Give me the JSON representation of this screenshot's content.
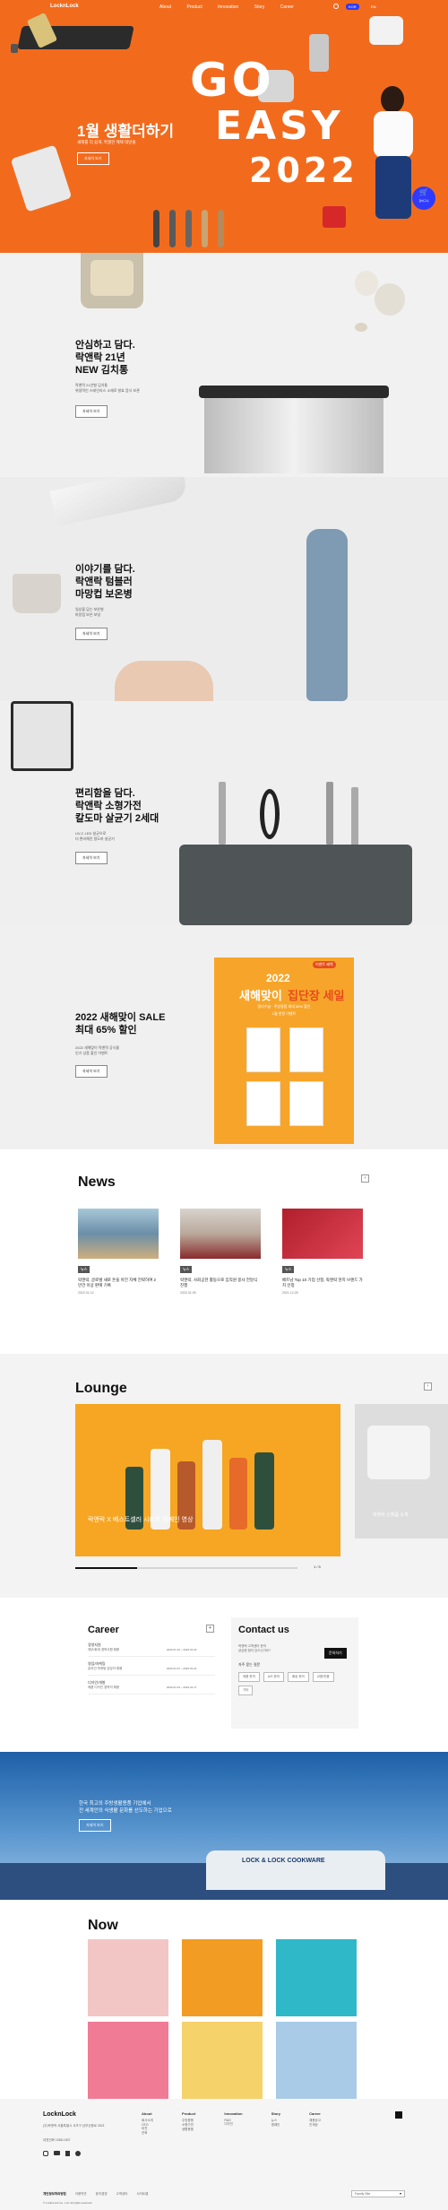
{
  "colors": {
    "hero_bg": "#f26b1d",
    "accent_blue": "#2e3bff",
    "sale_orange": "#f7a52a",
    "sale_red": "#e74b1c",
    "footer_bg": "#f5f5f5"
  },
  "header": {
    "logo": "LocknLock",
    "nav": [
      "About",
      "Product",
      "Innovation",
      "Story",
      "Career"
    ],
    "utils": {
      "search": "search-icon",
      "lang_btn": "KOR",
      "lang": "EN"
    }
  },
  "hero": {
    "title": "1월 생활더하기",
    "subtitle": "새해를 더 쉽게, 특별한 혜택 대방출",
    "more": "자세히 보기",
    "deco_top": "GO",
    "deco_mid": "EASY",
    "deco_year": "2022",
    "fab_label": "장바구니",
    "fab_icon": "cart-icon"
  },
  "promos": [
    {
      "title": "안심하고 담다.\n락앤락 21년\nNEW 김치통",
      "desc": "락앤락 21년형 김치통\n위생적인 스테인리스 소재로 발효 음식 보관",
      "more": "자세히 보기"
    },
    {
      "title": "이야기를 담다.\n락앤락 텀블러\n마망컵 보온병",
      "desc": "일상을 담는 보온병\n마망컵 보온 보냉",
      "more": "자세히 보기"
    },
    {
      "title": "편리함을 담다.\n락앤락 소형가전\n칼도마 살균기 2세대",
      "desc": "UV-C LED 살균으로\n더 편리해진 칼도마 살균기",
      "more": "자세히 보기"
    },
    {
      "title": "2022 새해맞이 SALE\n최대 65% 할인",
      "desc": "2022 새해맞이 락앤락 공식몰\n인기 상품 할인 이벤트",
      "more": "자세히 보기"
    }
  ],
  "sale_poster": {
    "badge": "이벤트 혜택",
    "year": "2022",
    "headline_1": "새해맞이",
    "headline_2": "집단장 세일",
    "sub_1": "정리수납 · 주방용품 최대 65% 할인",
    "sub_2": "1월 한정 이벤트",
    "grid_icons": [
      "storage-icon",
      "kitchen-icon",
      "cleaning-icon",
      "organizer-icon"
    ]
  },
  "news": {
    "heading": "News",
    "nav_icon": "arrow-icon",
    "items": [
      {
        "tag": "뉴스",
        "title": "락앤락, 글로벌 새로 돈을 아낀 자체 전략하여 2만건 이상 판매 기록",
        "date": "2022.01.12"
      },
      {
        "tag": "뉴스",
        "title": "락앤락, 사회공헌 활동으로 임직원 봉사 전달식 진행",
        "date": "2022.01.05"
      },
      {
        "tag": "뉴스",
        "title": "베트남 Top 10 기업 선정, 락앤락 현지 브랜드 가치 인정",
        "date": "2021.12.28"
      }
    ]
  },
  "lounge": {
    "heading": "Lounge",
    "main_caption": "락앤락 X 베스트셀러 시리즈 캠페인 영상",
    "side_caption": "락앤락 신제품 소개",
    "page": "1 / 5"
  },
  "career": {
    "heading": "Career",
    "add_icon": "plus-icon",
    "items": [
      {
        "cat": "경영지원",
        "title": "재무/회계 경력사원 채용",
        "date": "2022.01.10 ~ 2022.01.24"
      },
      {
        "cat": "영업/마케팅",
        "title": "온라인 마케팅 담당자 채용",
        "date": "2022.01.07 ~ 2022.01.21"
      },
      {
        "cat": "디자인/개발",
        "title": "제품 디자인 경력직 채용",
        "date": "2022.01.03 ~ 2022.01.17"
      }
    ]
  },
  "contact": {
    "heading": "Contact us",
    "desc": "락앤락 고객센터 문의\n궁금한 점이 있으신가요?",
    "cta": "문의하기",
    "faq_label": "자주 묻는 질문",
    "chips": [
      "제품 문의",
      "A/S 문의",
      "배송 문의",
      "교환/반품",
      "기타"
    ]
  },
  "banner": {
    "text": "한국 최고의 주방생활용품 기업에서\n전 세계인의 식생활 문화를 선도하는 기업으로",
    "more": "자세히 보기",
    "building_sign": "LOCK & LOCK COOKWARE"
  },
  "now": {
    "heading": "Now",
    "tiles": [
      "pink-product-tile",
      "orange-tumbler-tile",
      "teal-knife-tile",
      "pink-sale-tile",
      "yellow-tumbler-tile",
      "blue-container-tile"
    ]
  },
  "footer": {
    "logo": "LocknLock",
    "address": "(주)락앤락 서울특별시 서초구 남부순환로 2621",
    "phone": "대표전화 1588-1807",
    "copyright": "© LocknLock Co., Ltd. All rights reserved.",
    "social": [
      "instagram-icon",
      "youtube-icon",
      "facebook-icon",
      "blog-icon"
    ],
    "cols": [
      {
        "h": "About",
        "items": [
          "회사소개",
          "CEO",
          "비전",
          "연혁"
        ]
      },
      {
        "h": "Product",
        "items": [
          "주방용품",
          "소형가전",
          "생활용품"
        ]
      },
      {
        "h": "Innovation",
        "items": [
          "R&D",
          "디자인"
        ]
      },
      {
        "h": "Story",
        "items": [
          "뉴스",
          "캠페인"
        ]
      },
      {
        "h": "Career",
        "items": [
          "채용공고",
          "인재상"
        ]
      }
    ],
    "bottom_links": [
      "개인정보처리방침",
      "이용약관",
      "윤리경영",
      "고객센터",
      "사이트맵"
    ],
    "family_site": "Family Site"
  }
}
